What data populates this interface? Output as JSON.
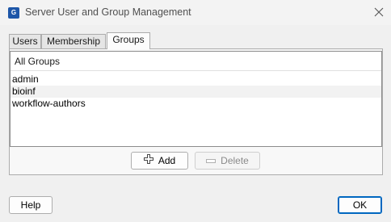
{
  "window": {
    "title": "Server User and Group Management",
    "app_icon_text": "G"
  },
  "tabs": [
    {
      "label": "Users",
      "active": false
    },
    {
      "label": "Membership",
      "active": false
    },
    {
      "label": "Groups",
      "active": true
    }
  ],
  "groups_list": {
    "header": "All Groups",
    "items": [
      "admin",
      "bioinf",
      "workflow-authors"
    ]
  },
  "actions": {
    "add_label": "Add",
    "delete_label": "Delete",
    "delete_enabled": false
  },
  "footer": {
    "help_label": "Help",
    "ok_label": "OK"
  },
  "colors": {
    "accent": "#0067c0",
    "app_icon": "#1d56a8"
  }
}
